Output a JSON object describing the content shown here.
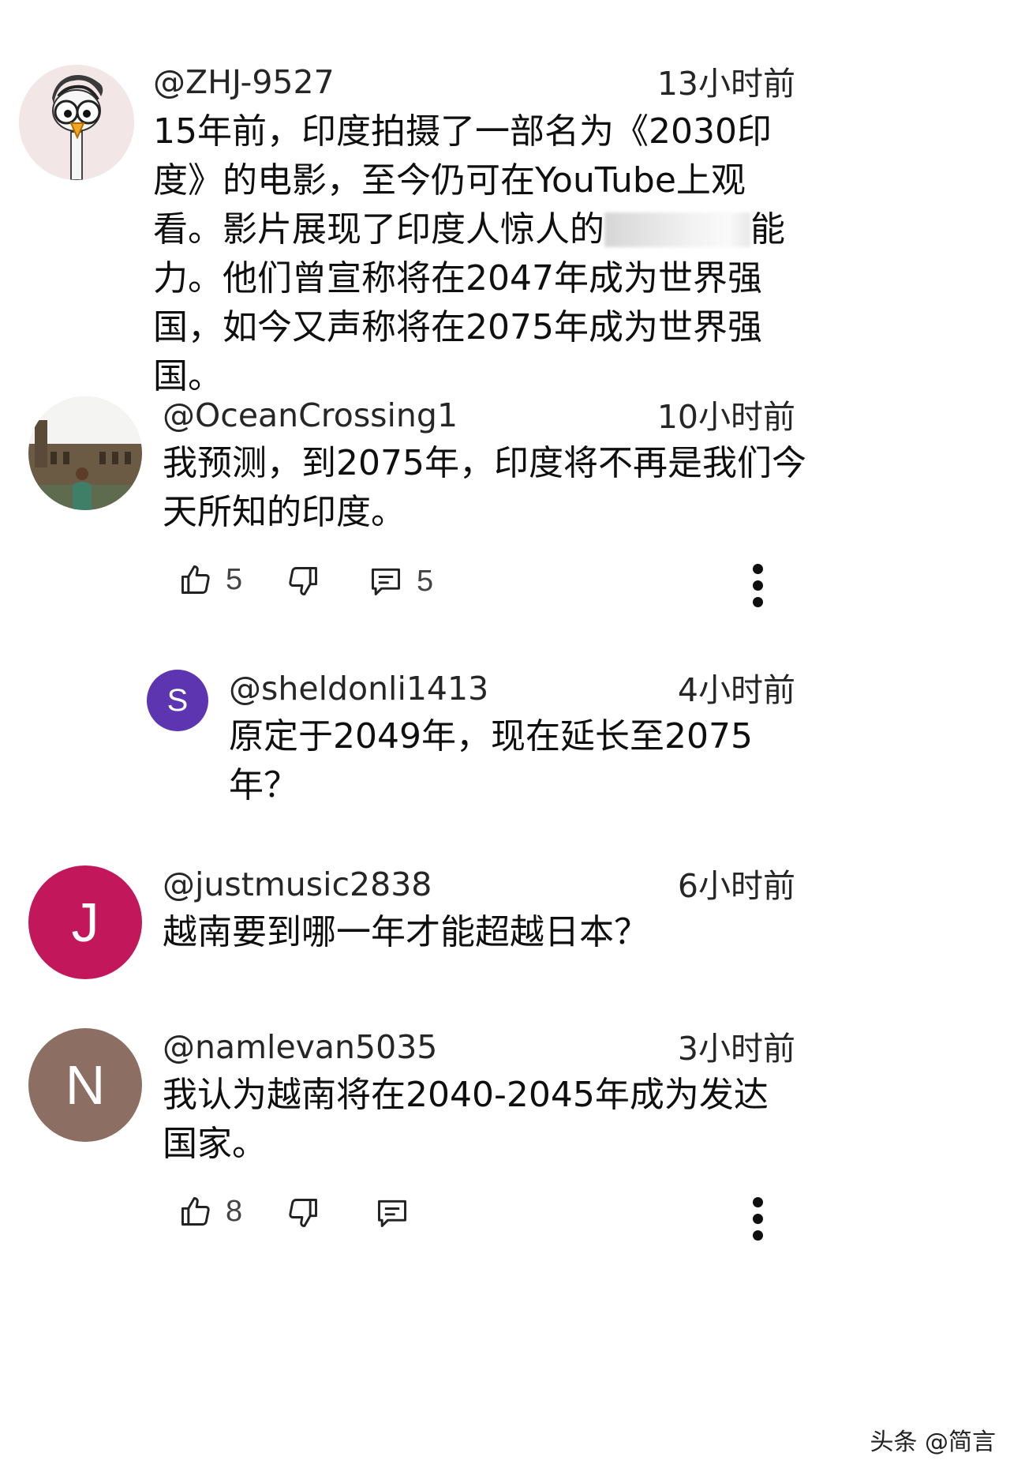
{
  "comments": [
    {
      "handle": "@ZHJ-9527",
      "time": "13小时前",
      "text_before": "15年前，印度拍摄了一部名为《2030印度》的电影，至今仍可在YouTube上观看。影片展现了印度人惊人的",
      "text_after": "能力。他们曾宣称将在2047年成为世界强国，如今又声称将在2075年成为世界强国。",
      "avatar_icon": "cartoon-bird-icon",
      "avatar_bg": "#f3e6e6"
    },
    {
      "handle": "@OceanCrossing1",
      "time": "10小时前",
      "text": "我预测，到2075年，印度将不再是我们今天所知的印度。",
      "avatar_icon": "photo-avatar",
      "likes": "5",
      "replies": "5"
    },
    {
      "handle": "@sheldonli1413",
      "time": "4小时前",
      "text": "原定于2049年，现在延长至2075年？",
      "avatar_letter": "S",
      "avatar_bg": "#5e35b1"
    },
    {
      "handle": "@justmusic2838",
      "time": "6小时前",
      "text": "越南要到哪一年才能超越日本？",
      "avatar_letter": "J",
      "avatar_bg": "#c2185b"
    },
    {
      "handle": "@namlevan5035",
      "time": "3小时前",
      "text": "我认为越南将在2040-2045年成为发达国家。",
      "avatar_letter": "N",
      "avatar_bg": "#8d6e63",
      "likes": "8"
    }
  ],
  "watermark": "头条 @简言",
  "icons": {
    "like": "thumbs-up-icon",
    "dislike": "thumbs-down-icon",
    "reply": "reply-comment-icon",
    "more": "more-vertical-icon"
  }
}
